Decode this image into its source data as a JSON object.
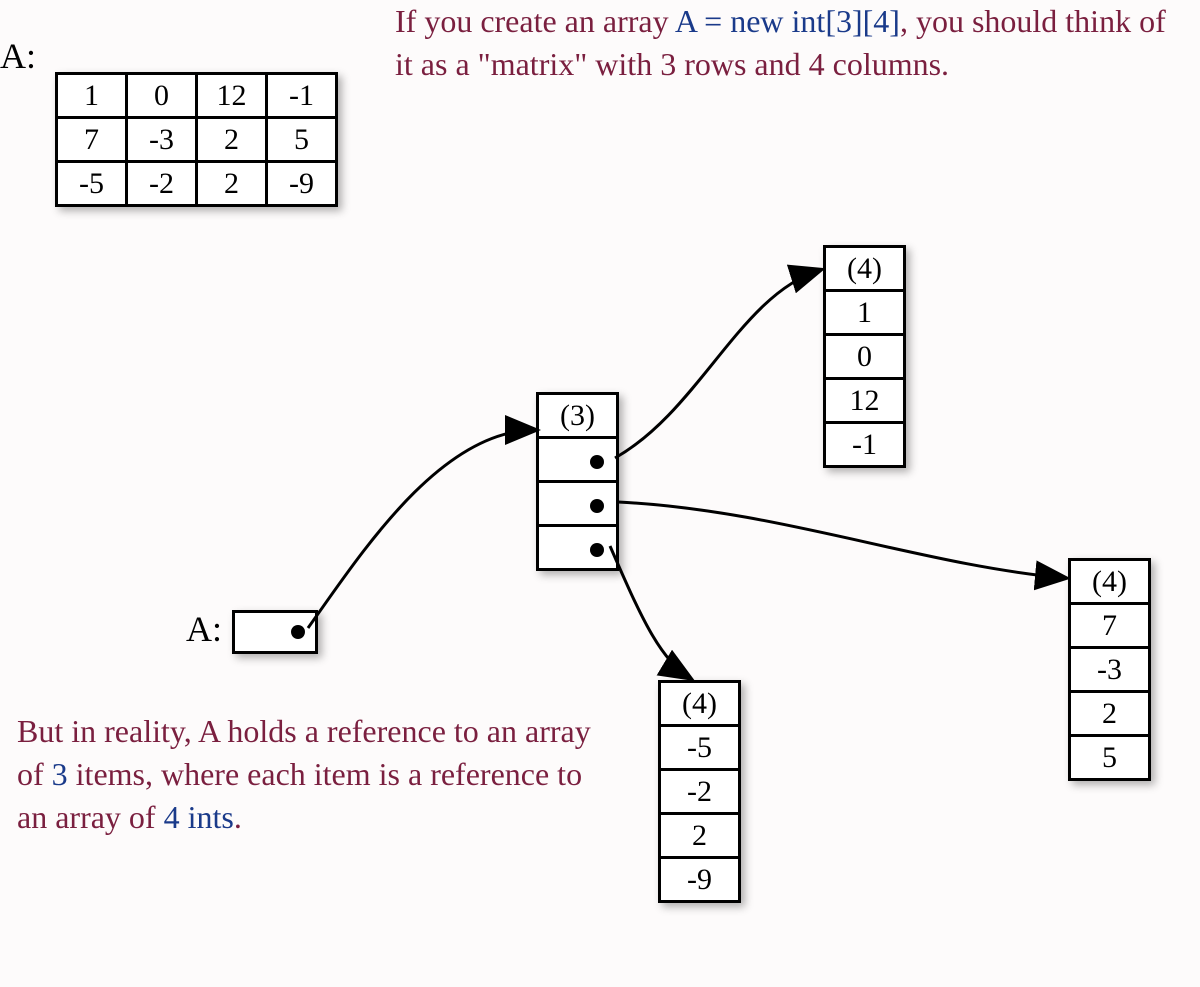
{
  "labels": {
    "a_top": "A:",
    "a_bottom": "A:"
  },
  "matrix": [
    [
      "1",
      "0",
      "12",
      "-1"
    ],
    [
      "7",
      "-3",
      "2",
      "5"
    ],
    [
      "-5",
      "-2",
      "2",
      "-9"
    ]
  ],
  "text_top": {
    "prefix": "If you create an array ",
    "code": "A = new int[3][4]",
    "suffix": ", you should think of it as a \"matrix\" with 3 rows and 4 columns."
  },
  "text_bottom": {
    "part1": "But in reality, A holds a reference to an array of ",
    "num1": "3",
    "part2": " items, where each item is a reference to an array of ",
    "num2": "4 ints",
    "part3": "."
  },
  "outer_array": {
    "header": "(3)"
  },
  "inner_arrays": [
    {
      "header": "(4)",
      "values": [
        "1",
        "0",
        "12",
        "-1"
      ]
    },
    {
      "header": "(4)",
      "values": [
        "-5",
        "-2",
        "2",
        "-9"
      ]
    },
    {
      "header": "(4)",
      "values": [
        "7",
        "-3",
        "2",
        "5"
      ]
    }
  ]
}
